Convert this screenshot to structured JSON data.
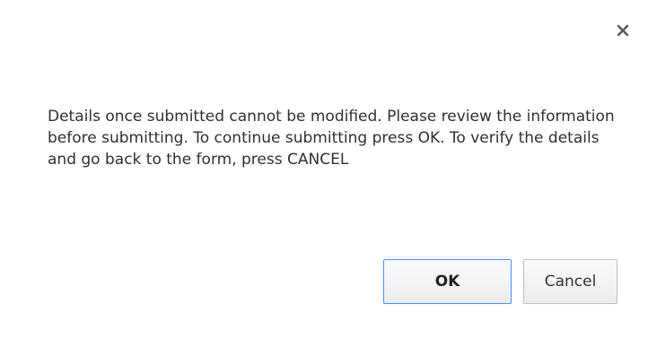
{
  "dialog": {
    "title": "",
    "message": "Details once submitted cannot be modified. Please review the information before submitting. To continue submitting press OK. To verify the details and go back to the form, press CANCEL",
    "close_icon": "close-icon",
    "buttons": {
      "ok_label": "OK",
      "cancel_label": "Cancel"
    },
    "colors": {
      "ok_border": "#4d90fe",
      "cancel_border": "#bfbfbf",
      "text": "#303030"
    }
  }
}
